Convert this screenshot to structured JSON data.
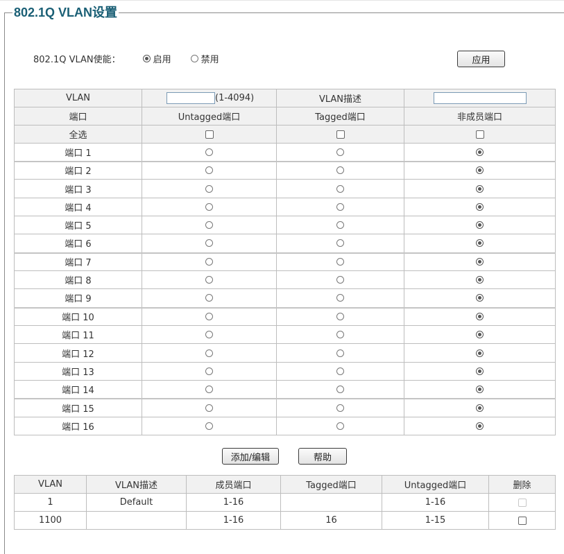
{
  "title": "802.1Q VLAN设置",
  "enable": {
    "label": "802.1Q VLAN使能：",
    "options": [
      {
        "label": "启用",
        "selected": true
      },
      {
        "label": "禁用",
        "selected": false
      }
    ],
    "apply_label": "应用"
  },
  "config": {
    "vlan_label": "VLAN",
    "vlan_range": "(1-4094)",
    "vlan_value": "",
    "desc_label": "VLAN描述",
    "desc_value": "",
    "headers": [
      "端口",
      "Untagged端口",
      "Tagged端口",
      "非成员端口"
    ],
    "select_all_label": "全选",
    "ports": [
      {
        "label": "端口 1",
        "selected": 2
      },
      {
        "label": "端口 2",
        "selected": 2
      },
      {
        "label": "端口 3",
        "selected": 2
      },
      {
        "label": "端口 4",
        "selected": 2
      },
      {
        "label": "端口 5",
        "selected": 2
      },
      {
        "label": "端口 6",
        "selected": 2
      },
      {
        "label": "端口 7",
        "selected": 2
      },
      {
        "label": "端口 8",
        "selected": 2
      },
      {
        "label": "端口 9",
        "selected": 2
      },
      {
        "label": "端口 10",
        "selected": 2
      },
      {
        "label": "端口 11",
        "selected": 2
      },
      {
        "label": "端口 12",
        "selected": 2
      },
      {
        "label": "端口 13",
        "selected": 2
      },
      {
        "label": "端口 14",
        "selected": 2
      },
      {
        "label": "端口 15",
        "selected": 2
      },
      {
        "label": "端口 16",
        "selected": 2
      }
    ]
  },
  "actions": {
    "add_edit_label": "添加/编辑",
    "help_label": "帮助"
  },
  "vlan_list": {
    "headers": [
      "VLAN",
      "VLAN描述",
      "成员端口",
      "Tagged端口",
      "Untagged端口",
      "删除"
    ],
    "rows": [
      {
        "vlan": "1",
        "desc": "Default",
        "members": "1-16",
        "tagged": "",
        "untagged": "1-16",
        "deletable": false
      },
      {
        "vlan": "1100",
        "desc": "",
        "members": "1-16",
        "tagged": "16",
        "untagged": "1-15",
        "deletable": true
      }
    ]
  }
}
